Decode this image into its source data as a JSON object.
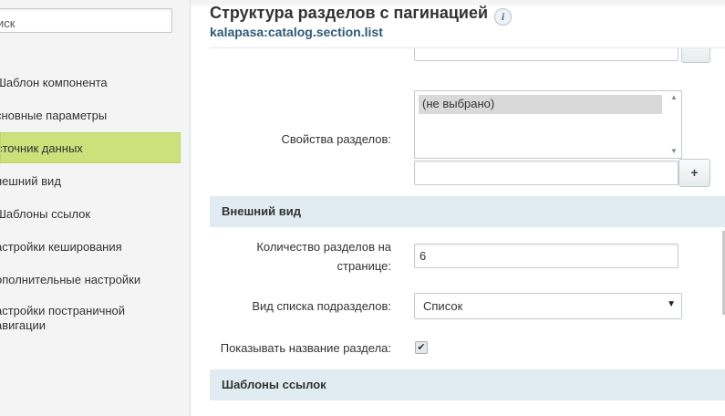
{
  "sidebar": {
    "search_placeholder": "иск",
    "items": [
      {
        "label": "Шаблон компонента"
      },
      {
        "label": "Основные параметры"
      },
      {
        "label": "Источник данных"
      },
      {
        "label": "Внешний вид"
      },
      {
        "label": "Шаблоны ссылок"
      },
      {
        "label": "Настройки кеширования"
      },
      {
        "label": "Дополнительные настройки"
      },
      {
        "label": "Настройки постраничной навигации"
      }
    ],
    "visible_items": [
      "Шаблон компонента",
      "сновные параметры",
      "сточник данных",
      "нешний вид",
      "Шаблоны ссылок",
      "астройки кеширования",
      "ополнительные настройки",
      "астройки постраничной\nавигации"
    ],
    "active_index": 2,
    "active_color": "#cee07b"
  },
  "header": {
    "title": "Структура разделов с пагинацией",
    "subtitle": "kalapasa:catalog.section.list",
    "info_icon": "info-icon"
  },
  "fields": {
    "section_props_label": "Свойства разделов:",
    "section_props_option": "(не выбрано)",
    "plus_label": "+",
    "appearance_head": "Внешний вид",
    "per_page_label_1": "Количество разделов на",
    "per_page_label_2": "странице:",
    "per_page_value": "6",
    "list_type_label": "Вид списка подразделов:",
    "list_type_value": "Список",
    "show_name_label": "Показывать название раздела:",
    "show_name_checked": true,
    "link_templates_head": "Шаблоны ссылок"
  },
  "colors": {
    "section_head_bg": "#e0ebf2",
    "subtitle": "#2d5a79"
  }
}
